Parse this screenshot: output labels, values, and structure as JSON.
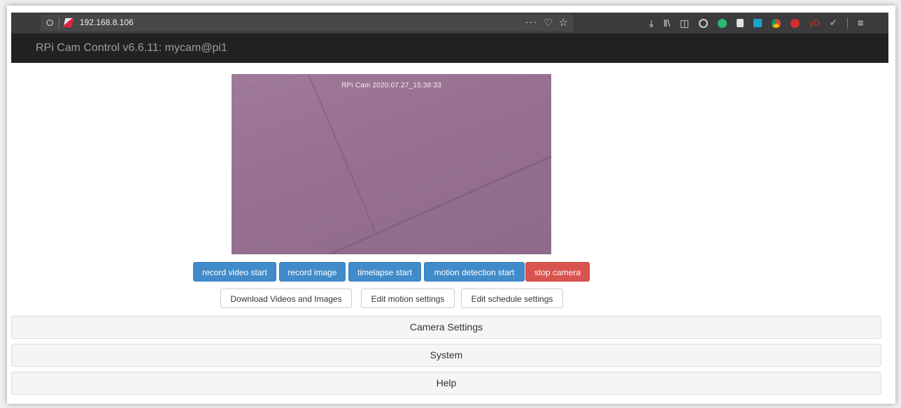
{
  "browser": {
    "url": "192.168.8.106",
    "overflow_menu_label": "···",
    "toolbar_icons": [
      "download-icon",
      "library-icon",
      "sidebar-icon",
      "account-icon",
      "extension-green-icon",
      "notes-icon",
      "extension-teal-icon",
      "chrome-icon",
      "adblock-icon",
      "yd-extension-icon",
      "check-icon",
      "hamburger-menu-icon"
    ],
    "yd_label": "yD"
  },
  "navbar": {
    "brand": "RPi Cam Control v6.6.11: mycam@pi1"
  },
  "preview": {
    "overlay_text": "RPi Cam  2020.07.27_15:38:33"
  },
  "actions": {
    "record_video": "record video start",
    "record_image": "record image",
    "timelapse": "timelapse start",
    "motion_detection": "motion detection start",
    "stop_camera": "stop camera"
  },
  "links": {
    "download": "Download Videos and Images",
    "edit_motion": "Edit motion settings",
    "edit_schedule": "Edit schedule settings"
  },
  "panels": {
    "camera_settings": "Camera Settings",
    "system": "System",
    "help": "Help"
  },
  "colors": {
    "navbar_bg": "#222222",
    "primary": "#428bca",
    "danger": "#d9534f",
    "preview_tint": "#976f91"
  }
}
